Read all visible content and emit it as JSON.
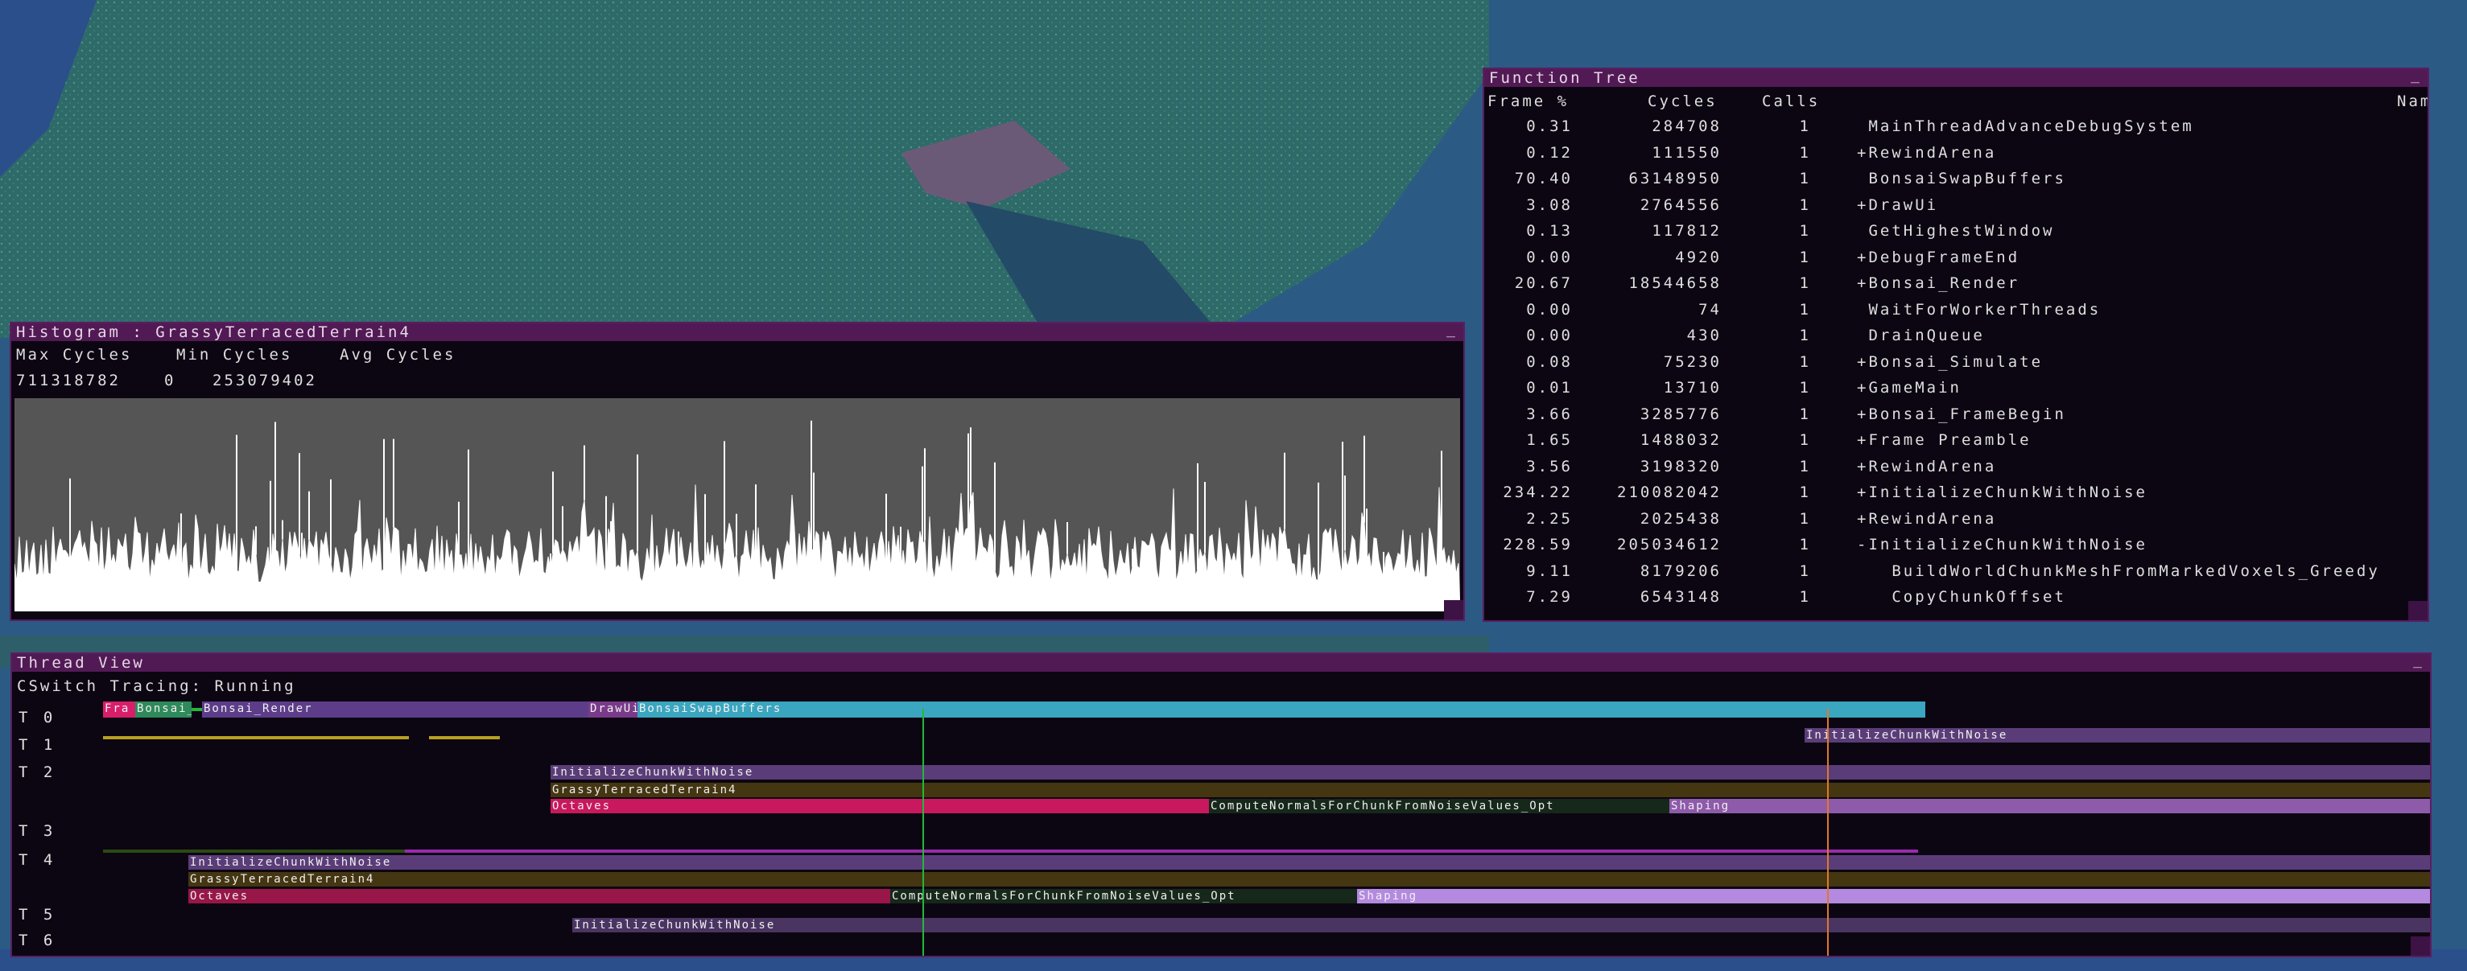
{
  "colors": {
    "panel_bg": "#0c0612",
    "titlebar": "#521a55",
    "panel_border": "#5a1e60",
    "histogram_bg": "#555555",
    "frame_marker_green": "#22b83a",
    "frame_marker_orange": "#e0782a"
  },
  "histogram": {
    "title": "Histogram : GrassyTerracedTerrain4",
    "minimize": "_",
    "headers": [
      "Max Cycles",
      "Min Cycles",
      "Avg Cycles"
    ],
    "values": [
      "711318782",
      "0",
      "253079402"
    ]
  },
  "function_tree": {
    "title": "Function Tree",
    "minimize": "_",
    "columns": [
      "Frame %",
      "Cycles",
      "Calls",
      "Nam"
    ],
    "rows": [
      {
        "pct": "0.31",
        "cycles": "284708",
        "calls": "1",
        "name": " MainThreadAdvanceDebugSystem"
      },
      {
        "pct": "0.12",
        "cycles": "111550",
        "calls": "1",
        "name": "+RewindArena"
      },
      {
        "pct": "70.40",
        "cycles": "63148950",
        "calls": "1",
        "name": " BonsaiSwapBuffers"
      },
      {
        "pct": "3.08",
        "cycles": "2764556",
        "calls": "1",
        "name": "+DrawUi"
      },
      {
        "pct": "0.13",
        "cycles": "117812",
        "calls": "1",
        "name": " GetHighestWindow"
      },
      {
        "pct": "0.00",
        "cycles": "4920",
        "calls": "1",
        "name": "+DebugFrameEnd"
      },
      {
        "pct": "20.67",
        "cycles": "18544658",
        "calls": "1",
        "name": "+Bonsai_Render"
      },
      {
        "pct": "0.00",
        "cycles": "74",
        "calls": "1",
        "name": " WaitForWorkerThreads"
      },
      {
        "pct": "0.00",
        "cycles": "430",
        "calls": "1",
        "name": " DrainQueue"
      },
      {
        "pct": "0.08",
        "cycles": "75230",
        "calls": "1",
        "name": "+Bonsai_Simulate"
      },
      {
        "pct": "0.01",
        "cycles": "13710",
        "calls": "1",
        "name": "+GameMain"
      },
      {
        "pct": "3.66",
        "cycles": "3285776",
        "calls": "1",
        "name": "+Bonsai_FrameBegin"
      },
      {
        "pct": "1.65",
        "cycles": "1488032",
        "calls": "1",
        "name": "+Frame Preamble"
      },
      {
        "pct": "3.56",
        "cycles": "3198320",
        "calls": "1",
        "name": "+RewindArena"
      },
      {
        "pct": "234.22",
        "cycles": "210082042",
        "calls": "1",
        "name": "+InitializeChunkWithNoise"
      },
      {
        "pct": "2.25",
        "cycles": "2025438",
        "calls": "1",
        "name": "+RewindArena"
      },
      {
        "pct": "228.59",
        "cycles": "205034612",
        "calls": "1",
        "name": "-InitializeChunkWithNoise"
      },
      {
        "pct": "9.11",
        "cycles": "8179206",
        "calls": "1",
        "name": "   BuildWorldChunkMeshFromMarkedVoxels_Greedy"
      },
      {
        "pct": "7.29",
        "cycles": "6543148",
        "calls": "1",
        "name": "   CopyChunkOffset"
      }
    ]
  },
  "thread_view": {
    "title": "Thread View",
    "minimize": "_",
    "status": "CSwitch Tracing: Running",
    "lanes": [
      "T 0",
      "T 1",
      "T 2",
      "T 3",
      "T 4",
      "T 5",
      "T 6"
    ],
    "bars": [
      {
        "label": "Fra",
        "color": "#d81e6a"
      },
      {
        "label": "Bonsai_",
        "color": "#2e8a5a"
      },
      {
        "label": "Bonsai_Render",
        "color": "#5d3d8a"
      },
      {
        "label": "DrawUi",
        "color": "#7a3a8a"
      },
      {
        "label": "BonsaiSwapBuffers",
        "color": "#3aa6c0"
      },
      {
        "label": "InitializeChunkWithNoise",
        "color": "#5a3d78"
      },
      {
        "label": "InitializeChunkWithNoise",
        "color": "#5a3d78"
      },
      {
        "label": "GrassyTerracedTerrain4",
        "color": "#453612"
      },
      {
        "label": "Octaves",
        "color": "#c8185e"
      },
      {
        "label": "ComputeNormalsForChunkFromNoiseValues_Opt",
        "color": "#16281a"
      },
      {
        "label": "Shaping",
        "color": "#8e5aaa"
      },
      {
        "label": "InitializeChunkWithNoise",
        "color": "#5a3d78"
      },
      {
        "label": "GrassyTerracedTerrain4",
        "color": "#453612"
      },
      {
        "label": "Octaves",
        "color": "#981648"
      },
      {
        "label": "ComputeNormalsForChunkFromNoiseValues_Opt",
        "color": "#16281a"
      },
      {
        "label": "Shaping",
        "color": "#b48ae0"
      },
      {
        "label": "InitializeChunkWithNoise",
        "color": "#4a3562"
      }
    ]
  }
}
